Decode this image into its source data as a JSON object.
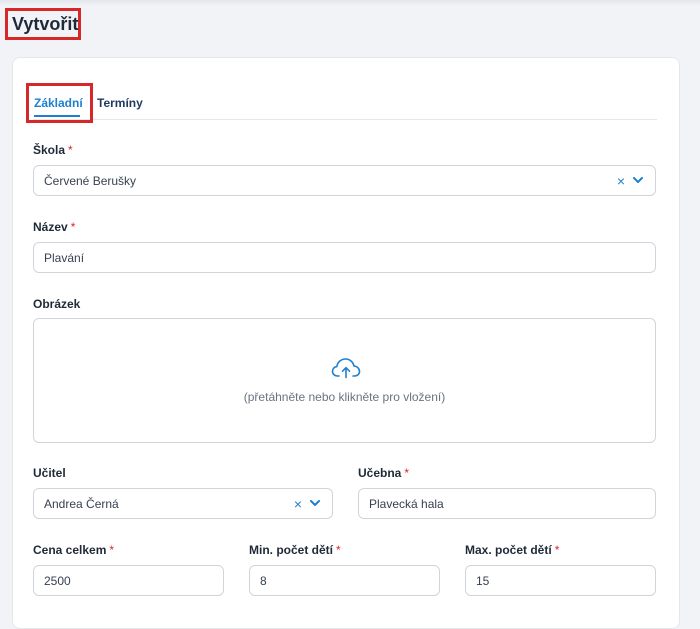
{
  "page": {
    "title": "Vytvořit"
  },
  "tabs": [
    {
      "label": "Základní",
      "active": true
    },
    {
      "label": "Termíny",
      "active": false
    }
  ],
  "form": {
    "required_mark": "*",
    "school": {
      "label": "Škola",
      "value": "Červené Berušky"
    },
    "name": {
      "label": "Název",
      "value": "Plavání"
    },
    "image": {
      "label": "Obrázek",
      "hint": "(přetáhněte nebo klikněte pro vložení)"
    },
    "teacher": {
      "label": "Učitel",
      "value": "Andrea Černá"
    },
    "classroom": {
      "label": "Učebna",
      "value": "Plavecká hala"
    },
    "total_price": {
      "label": "Cena celkem",
      "value": "2500"
    },
    "min_children": {
      "label": "Min. počet dětí",
      "value": "8"
    },
    "max_children": {
      "label": "Max. počet dětí",
      "value": "15"
    }
  },
  "icons": {
    "clear": "×",
    "upload": "cloud-upload-icon",
    "chevron": "chevron-down-icon"
  },
  "colors": {
    "accent": "#1d80d0",
    "required": "#dc2626",
    "highlight_box": "#d62828"
  }
}
